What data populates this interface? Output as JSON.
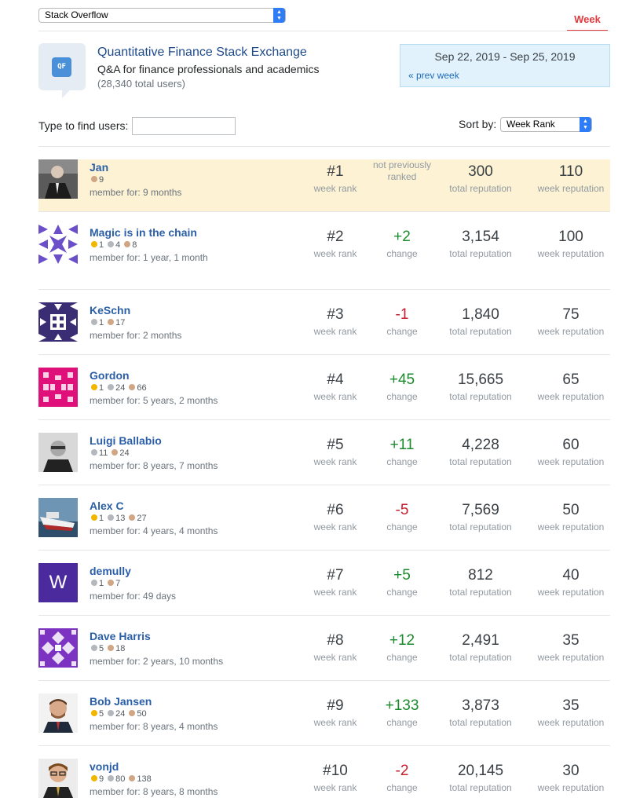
{
  "site_selector": {
    "value": "Stack Overflow"
  },
  "tabs": {
    "week": "Week"
  },
  "site": {
    "logo_text": "QF",
    "name": "Quantitative Finance Stack Exchange",
    "description": "Q&A for finance professionals and academics",
    "users": "(28,340 total users)"
  },
  "date_range": {
    "range": "Sep 22, 2019 - Sep 25, 2019",
    "prev": "« prev week"
  },
  "filter": {
    "find_label": "Type to find users:",
    "find_value": "",
    "sort_label": "Sort by:",
    "sort_value": "Week Rank"
  },
  "labels": {
    "week_rank": "week rank",
    "change": "change",
    "total_rep": "total reputation",
    "week_rep": "week reputation"
  },
  "users": [
    {
      "name": "Jan",
      "gold": "",
      "silver": "",
      "bronze": "9",
      "member": "member for: 9 months",
      "rank": "#1",
      "change": "not previously ranked",
      "change_dir": "none",
      "total": "300",
      "week": "110"
    },
    {
      "name": "Magic is in the chain",
      "gold": "1",
      "silver": "4",
      "bronze": "8",
      "member": "member for: 1 year, 1 month",
      "rank": "#2",
      "change": "+2",
      "change_dir": "up",
      "total": "3,154",
      "week": "100"
    },
    {
      "name": "KeSchn",
      "gold": "",
      "silver": "1",
      "bronze": "17",
      "member": "member for: 2 months",
      "rank": "#3",
      "change": "-1",
      "change_dir": "down",
      "total": "1,840",
      "week": "75"
    },
    {
      "name": "Gordon",
      "gold": "1",
      "silver": "24",
      "bronze": "66",
      "member": "member for: 5 years, 2 months",
      "rank": "#4",
      "change": "+45",
      "change_dir": "up",
      "total": "15,665",
      "week": "65"
    },
    {
      "name": "Luigi Ballabio",
      "gold": "",
      "silver": "11",
      "bronze": "24",
      "member": "member for: 8 years, 7 months",
      "rank": "#5",
      "change": "+11",
      "change_dir": "up",
      "total": "4,228",
      "week": "60"
    },
    {
      "name": "Alex C",
      "gold": "1",
      "silver": "13",
      "bronze": "27",
      "member": "member for: 4 years, 4 months",
      "rank": "#6",
      "change": "-5",
      "change_dir": "down",
      "total": "7,569",
      "week": "50"
    },
    {
      "name": "demully",
      "gold": "",
      "silver": "1",
      "bronze": "7",
      "member": "member for: 49 days",
      "rank": "#7",
      "change": "+5",
      "change_dir": "up",
      "total": "812",
      "week": "40",
      "avatar_letter": "W"
    },
    {
      "name": "Dave Harris",
      "gold": "",
      "silver": "5",
      "bronze": "18",
      "member": "member for: 2 years, 10 months",
      "rank": "#8",
      "change": "+12",
      "change_dir": "up",
      "total": "2,491",
      "week": "35"
    },
    {
      "name": "Bob Jansen",
      "gold": "5",
      "silver": "24",
      "bronze": "50",
      "member": "member for: 8 years, 4 months",
      "rank": "#9",
      "change": "+133",
      "change_dir": "up",
      "total": "3,873",
      "week": "35"
    },
    {
      "name": "vonjd",
      "gold": "9",
      "silver": "80",
      "bronze": "138",
      "member": "member for: 8 years, 8 months",
      "rank": "#10",
      "change": "-2",
      "change_dir": "down",
      "total": "20,145",
      "week": "30"
    }
  ],
  "colors": {
    "accent": "#e0393e",
    "link": "#2a5fa8",
    "up": "#1b8a2c",
    "down": "#c91d2e",
    "highlight": "#fdf3d4"
  }
}
